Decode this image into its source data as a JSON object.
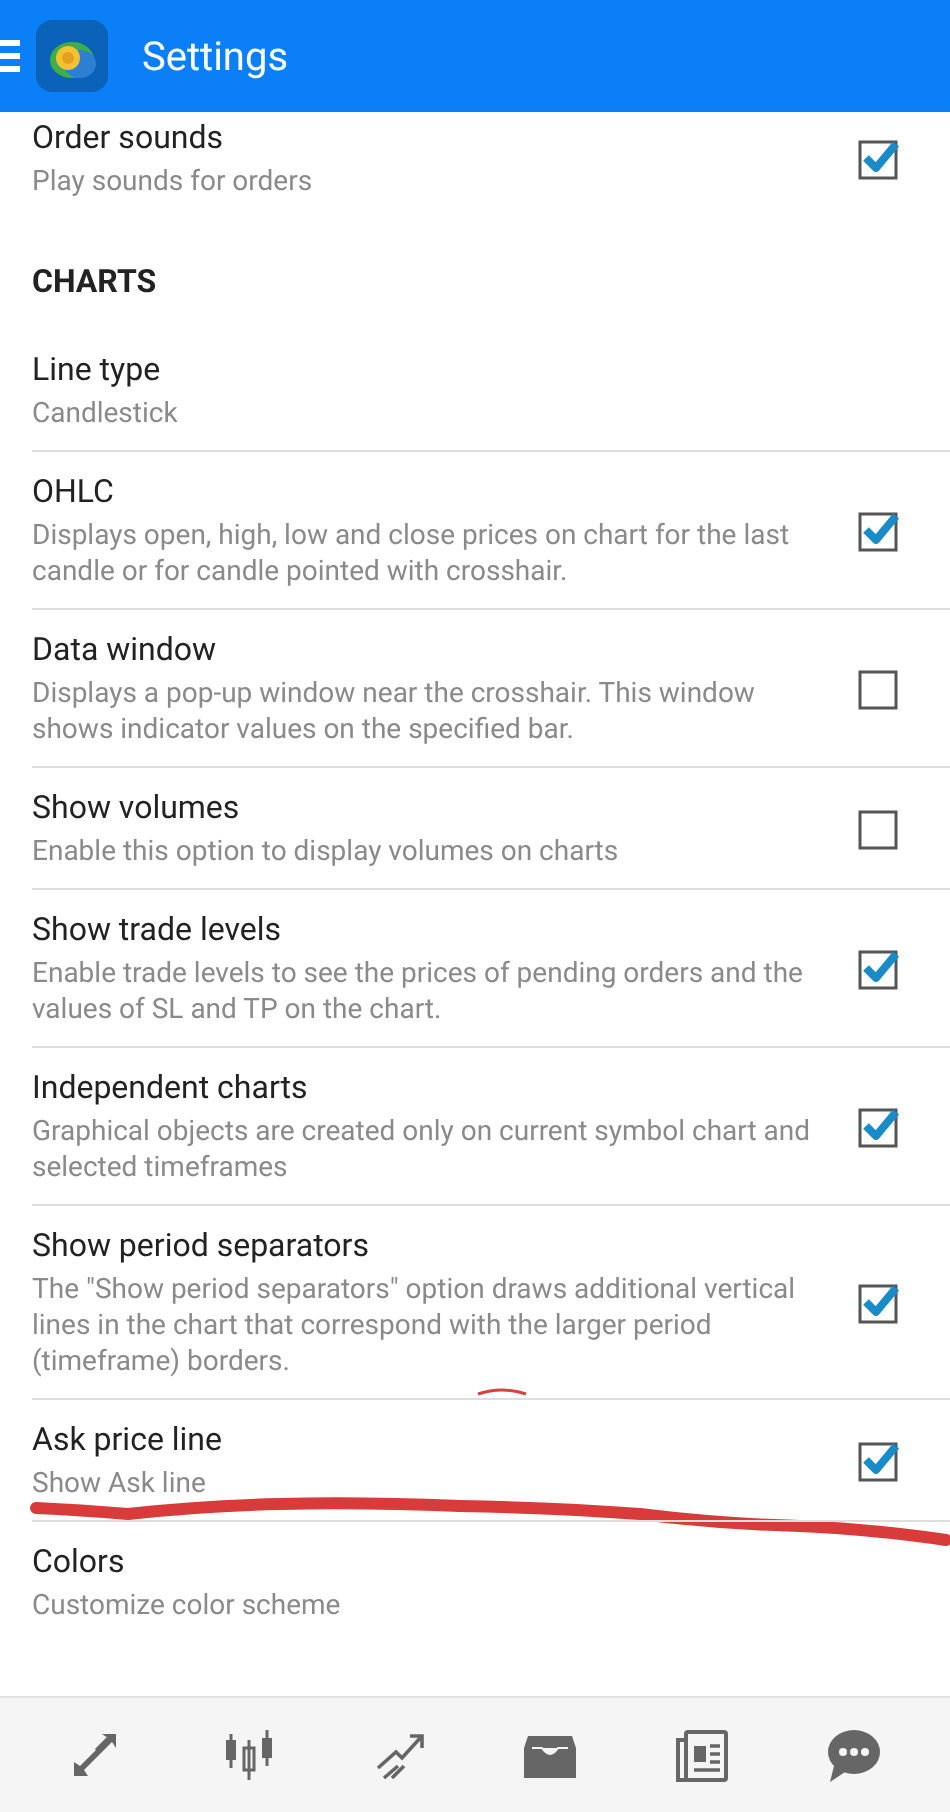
{
  "app_bar": {
    "title": "Settings"
  },
  "top_items": [
    {
      "title": "Order sounds",
      "description": "Play sounds for orders",
      "kind": "checkbox",
      "checked": true
    }
  ],
  "section": {
    "heading": "CHARTS"
  },
  "items": [
    {
      "title": "Line type",
      "description": "Candlestick",
      "kind": "value"
    },
    {
      "title": "OHLC",
      "description": "Displays open, high, low and close prices on chart for the last candle or for candle pointed with crosshair.",
      "kind": "checkbox",
      "checked": true
    },
    {
      "title": "Data window",
      "description": "Displays a pop-up window near the crosshair. This window shows indicator values on the specified bar.",
      "kind": "checkbox",
      "checked": false
    },
    {
      "title": "Show volumes",
      "description": "Enable this option to display volumes on charts",
      "kind": "checkbox",
      "checked": false
    },
    {
      "title": "Show trade levels",
      "description": "Enable trade levels to see the prices of pending orders and the values of SL and TP on the chart.",
      "kind": "checkbox",
      "checked": true
    },
    {
      "title": "Independent charts",
      "description": "Graphical objects are created only on current symbol chart and selected timeframes",
      "kind": "checkbox",
      "checked": true
    },
    {
      "title": "Show period separators",
      "description": "The \"Show period separators\" option draws additional vertical lines in the chart that correspond with the larger period (timeframe) borders.",
      "kind": "checkbox",
      "checked": true,
      "ink_mark": {
        "kind": "arc"
      }
    },
    {
      "title": "Ask price line",
      "description": "Show Ask line",
      "kind": "checkbox",
      "checked": true,
      "ink_mark": {
        "kind": "stroke"
      }
    },
    {
      "title": "Colors",
      "description": "Customize color scheme",
      "kind": "value"
    }
  ],
  "bottom_nav": [
    {
      "kind": "quotes"
    },
    {
      "kind": "chart"
    },
    {
      "kind": "trade"
    },
    {
      "kind": "history"
    },
    {
      "kind": "news"
    },
    {
      "kind": "chat"
    }
  ]
}
